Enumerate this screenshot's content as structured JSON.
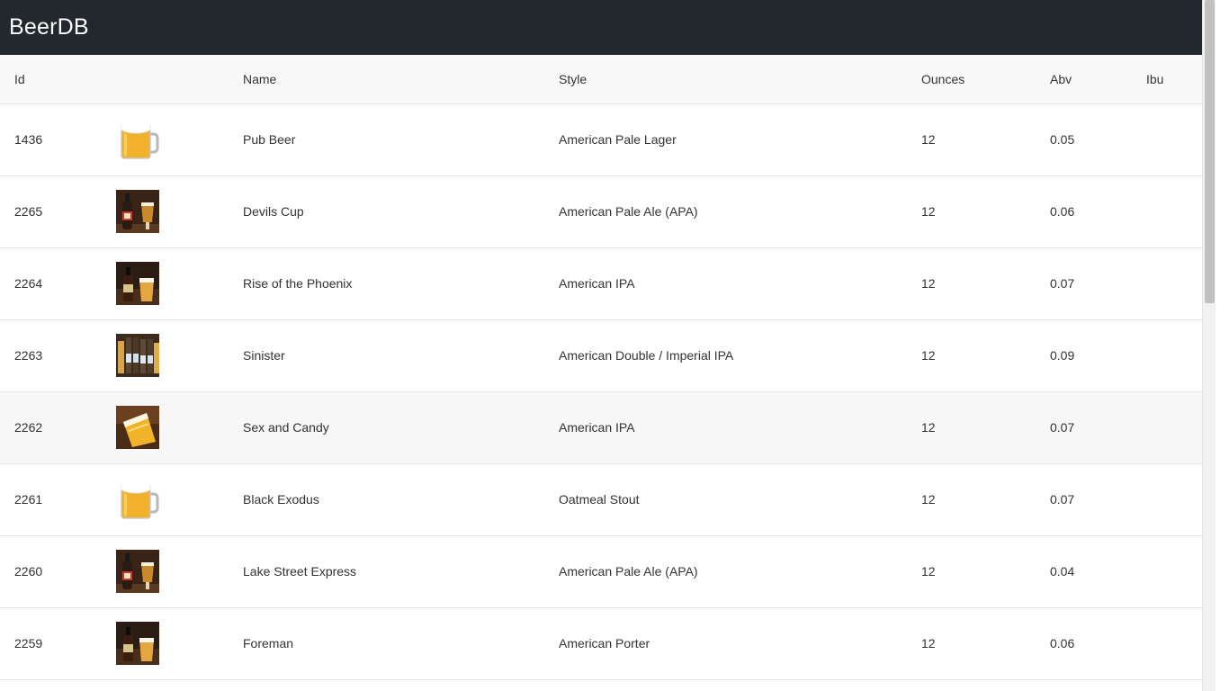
{
  "app": {
    "title": "BeerDB"
  },
  "table": {
    "headers": {
      "id": "Id",
      "image": "",
      "name": "Name",
      "style": "Style",
      "ounces": "Ounces",
      "abv": "Abv",
      "ibu": "Ibu"
    },
    "rows": [
      {
        "id": "1436",
        "image": "beer-mug",
        "name": "Pub Beer",
        "style": "American Pale Lager",
        "ounces": "12",
        "abv": "0.05",
        "ibu": ""
      },
      {
        "id": "2265",
        "image": "bottle-and-glass",
        "name": "Devils Cup",
        "style": "American Pale Ale (APA)",
        "ounces": "12",
        "abv": "0.06",
        "ibu": ""
      },
      {
        "id": "2264",
        "image": "bottle-and-glass-dark",
        "name": "Rise of the Phoenix",
        "style": "American IPA",
        "ounces": "12",
        "abv": "0.07",
        "ibu": ""
      },
      {
        "id": "2263",
        "image": "bottles-lineup",
        "name": "Sinister",
        "style": "American Double / Imperial IPA",
        "ounces": "12",
        "abv": "0.09",
        "ibu": ""
      },
      {
        "id": "2262",
        "image": "beer-pour",
        "name": "Sex and Candy",
        "style": "American IPA",
        "ounces": "12",
        "abv": "0.07",
        "ibu": ""
      },
      {
        "id": "2261",
        "image": "beer-mug",
        "name": "Black Exodus",
        "style": "Oatmeal Stout",
        "ounces": "12",
        "abv": "0.07",
        "ibu": ""
      },
      {
        "id": "2260",
        "image": "bottle-and-glass",
        "name": "Lake Street Express",
        "style": "American Pale Ale (APA)",
        "ounces": "12",
        "abv": "0.04",
        "ibu": ""
      },
      {
        "id": "2259",
        "image": "bottle-and-glass-dark",
        "name": "Foreman",
        "style": "American Porter",
        "ounces": "12",
        "abv": "0.06",
        "ibu": ""
      }
    ]
  },
  "colors": {
    "navbar": "#23272e",
    "header_row": "#f9f9f9",
    "row_border": "#e6e6e6",
    "hover_row": "#f7f7f7"
  }
}
